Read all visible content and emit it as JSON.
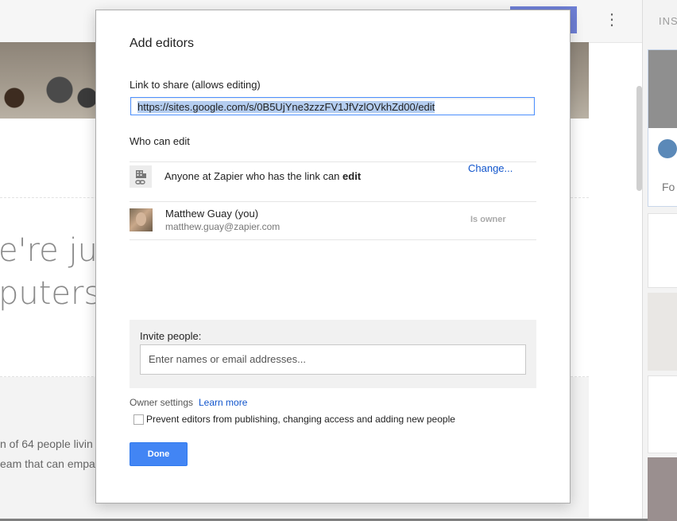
{
  "background": {
    "headline_line1": "e're jus",
    "headline_line2": "puters",
    "body_line1": "n of 64 people livin",
    "body_line2": "eam that can empat",
    "right_panel_tab": "INS",
    "right_panel_card_text": "Fo"
  },
  "dialog": {
    "title": "Add editors",
    "link_label": "Link to share (allows editing)",
    "link_value": "https://sites.google.com/s/0B5UjYne3zzzFV1JfVzlOVkhZd00/edit",
    "who_can_edit_label": "Who can edit",
    "permission": {
      "icon": "building-link-icon",
      "text_prefix": "Anyone at Zapier who has the link can ",
      "text_bold": "edit",
      "change_label": "Change..."
    },
    "owner": {
      "name": "Matthew Guay (you)",
      "email": "matthew.guay@zapier.com",
      "role": "Is owner"
    },
    "invite": {
      "label": "Invite people:",
      "placeholder": "Enter names or email addresses..."
    },
    "owner_settings": {
      "label": "Owner settings",
      "learn_more": "Learn more",
      "checkbox_label": "Prevent editors from publishing, changing access and adding new people",
      "checked": false
    },
    "done_label": "Done"
  },
  "colors": {
    "primary_button": "#4285f4",
    "link": "#1155cc",
    "selection": "#b4cdf0"
  }
}
